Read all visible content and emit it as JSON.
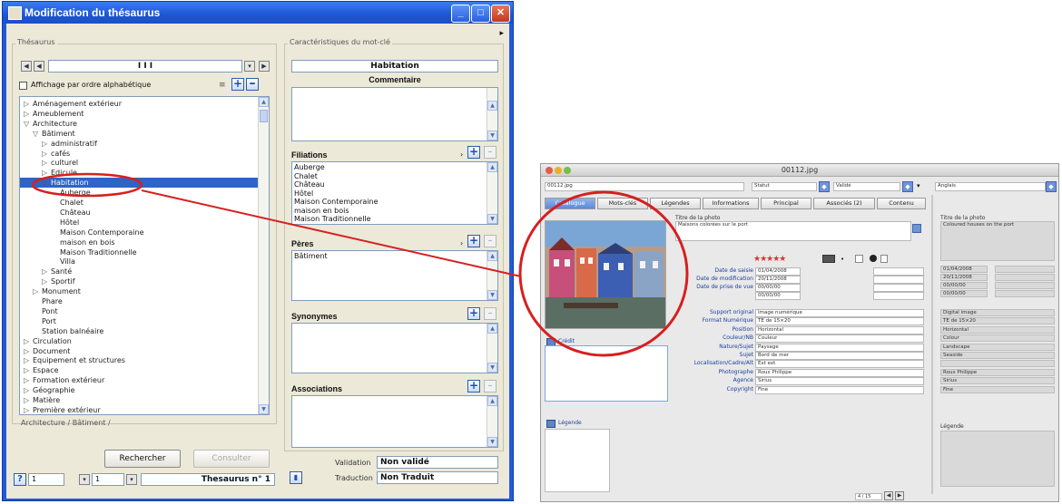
{
  "dialog": {
    "title": "Modification du thésaurus",
    "thesaurus_group": "Thésaurus",
    "nav_field": "I I I",
    "sort_checkbox": "Affichage par ordre alphabétique",
    "tree": [
      {
        "label": "Aménagement extérieur",
        "level": 0,
        "exp": "▷"
      },
      {
        "label": "Ameublement",
        "level": 0,
        "exp": "▷"
      },
      {
        "label": "Architecture",
        "level": 0,
        "exp": "▽"
      },
      {
        "label": "Bâtiment",
        "level": 1,
        "exp": "▽"
      },
      {
        "label": "administratif",
        "level": 2,
        "exp": "▷"
      },
      {
        "label": "cafés",
        "level": 2,
        "exp": "▷"
      },
      {
        "label": "culturel",
        "level": 2,
        "exp": "▷"
      },
      {
        "label": "Edicule",
        "level": 2,
        "exp": "▷"
      },
      {
        "label": "Habitation",
        "level": 2,
        "exp": "▽",
        "selected": true
      },
      {
        "label": "Auberge",
        "level": 3,
        "exp": ""
      },
      {
        "label": "Chalet",
        "level": 3,
        "exp": ""
      },
      {
        "label": "Château",
        "level": 3,
        "exp": ""
      },
      {
        "label": "Hôtel",
        "level": 3,
        "exp": ""
      },
      {
        "label": "Maison Contemporaine",
        "level": 3,
        "exp": ""
      },
      {
        "label": "maison en bois",
        "level": 3,
        "exp": ""
      },
      {
        "label": "Maison Traditionnelle",
        "level": 3,
        "exp": ""
      },
      {
        "label": "Villa",
        "level": 3,
        "exp": ""
      },
      {
        "label": "Santé",
        "level": 2,
        "exp": "▷"
      },
      {
        "label": "Sportif",
        "level": 2,
        "exp": "▷"
      },
      {
        "label": "Monument",
        "level": 1,
        "exp": "▷"
      },
      {
        "label": "Phare",
        "level": 1,
        "exp": ""
      },
      {
        "label": "Pont",
        "level": 1,
        "exp": ""
      },
      {
        "label": "Port",
        "level": 1,
        "exp": ""
      },
      {
        "label": "Station balnéaire",
        "level": 1,
        "exp": ""
      },
      {
        "label": "Circulation",
        "level": 0,
        "exp": "▷"
      },
      {
        "label": "Document",
        "level": 0,
        "exp": "▷"
      },
      {
        "label": "Equipement et structures",
        "level": 0,
        "exp": "▷"
      },
      {
        "label": "Espace",
        "level": 0,
        "exp": "▷"
      },
      {
        "label": "Formation extérieur",
        "level": 0,
        "exp": "▷"
      },
      {
        "label": "Géographie",
        "level": 0,
        "exp": "▷"
      },
      {
        "label": "Matière",
        "level": 0,
        "exp": "▷"
      },
      {
        "label": "Première extérieur",
        "level": 0,
        "exp": "▷"
      }
    ],
    "path": "Architecture / Bâtiment /",
    "search_button": "Rechercher",
    "consult_button": "Consulter",
    "footer_page": "1",
    "footer_page2": "1",
    "thesaurus_label": "Thesaurus n° 1",
    "chars_group": "Caractéristiques du mot-clé",
    "keyword": "Habitation",
    "comment_title": "Commentaire",
    "filiations_title": "Filiations",
    "filiations": [
      "Auberge",
      "Chalet",
      "Château",
      "Hôtel",
      "Maison Contemporaine",
      "maison en bois",
      "Maison Traditionnelle"
    ],
    "peres_title": "Pères",
    "peres": [
      "Bâtiment"
    ],
    "synonymes_title": "Synonymes",
    "associations_title": "Associations",
    "validation_label": "Validation",
    "validation_value": "Non validé",
    "traduction_label": "Traduction",
    "traduction_value": "Non Traduit"
  },
  "mac": {
    "title": "00112.jpg",
    "file_field": "00112.jpg",
    "dropdown1": "Statut",
    "dropdown2": "Validé",
    "dropdown3": "Anglais",
    "tabs": [
      "Catalogue",
      "Mots-clés",
      "Légendes",
      "Informations",
      "Principal",
      "Associés (2)",
      "Contenu"
    ],
    "legend_title": "Titre de la photo",
    "legend_text": "Maisons colorées sur le port",
    "right_legend_title": "Titre de la photo",
    "right_legend_text": "Coloured houses on the port",
    "stars": "★★★★★",
    "date_labels": [
      "Date de saisie",
      "Date de modification",
      "Date de prise de vue"
    ],
    "dates": [
      "01/04/2008",
      "20/11/2008",
      "00/00/00",
      "00/00/00"
    ],
    "meta": [
      {
        "label": "Support original",
        "value": "Image numérique"
      },
      {
        "label": "Format Numérique",
        "value": "TE de 15×20"
      },
      {
        "label": "Position",
        "value": "Horizontal"
      },
      {
        "label": "Couleur/NB",
        "value": "Couleur"
      },
      {
        "label": "Nature/Sujet",
        "value": "Paysage"
      },
      {
        "label": "Sujet",
        "value": "Bord de mer"
      },
      {
        "label": "Localisation/Cadre/Alt",
        "value": "Ext ext"
      },
      {
        "label": "Photographe",
        "value": "Roux Philippe"
      },
      {
        "label": "Agence",
        "value": "Sirius"
      },
      {
        "label": "Copyright",
        "value": "Fine"
      }
    ],
    "right_meta": [
      "Digital image",
      "TE de 15×20",
      "Horizontal",
      "Colour",
      "Landscape",
      "Seaside",
      "",
      "Roux Philippe",
      "Sirius",
      "Fine"
    ],
    "side_panel_label": "Crédit",
    "bottom_panel_label": "Légende",
    "right_bottom_label": "Légende",
    "pager": "4 / 15"
  },
  "annotation_color": "#d62020"
}
